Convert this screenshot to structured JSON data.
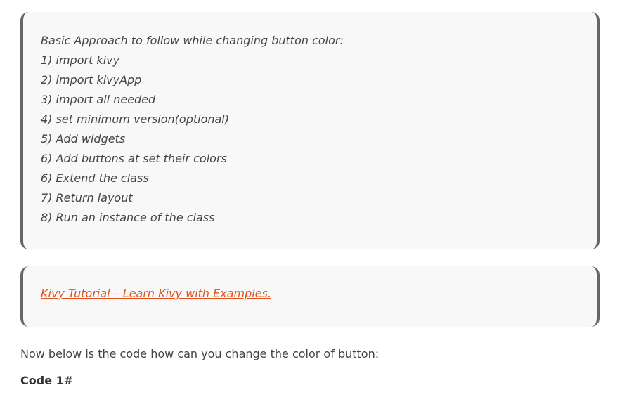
{
  "approach_box": {
    "lines": [
      "Basic Approach to follow while changing button color:",
      "1) import kivy",
      "2) import kivyApp",
      "3) import all needed",
      "4) set minimum version(optional)",
      "5) Add widgets",
      "6) Add buttons at set their colors",
      "6) Extend the class",
      "7) Return layout",
      "8) Run an instance of the class"
    ]
  },
  "link_box": {
    "link_text": "Kivy Tutorial – Learn Kivy with Examples."
  },
  "paragraph": "Now below is the code how can you change the color of button:",
  "code_heading": "Code 1#",
  "colors": {
    "link": "#e0531e",
    "quote_background": "#f8f8f8",
    "quote_border": "#666666",
    "text": "#444444"
  }
}
